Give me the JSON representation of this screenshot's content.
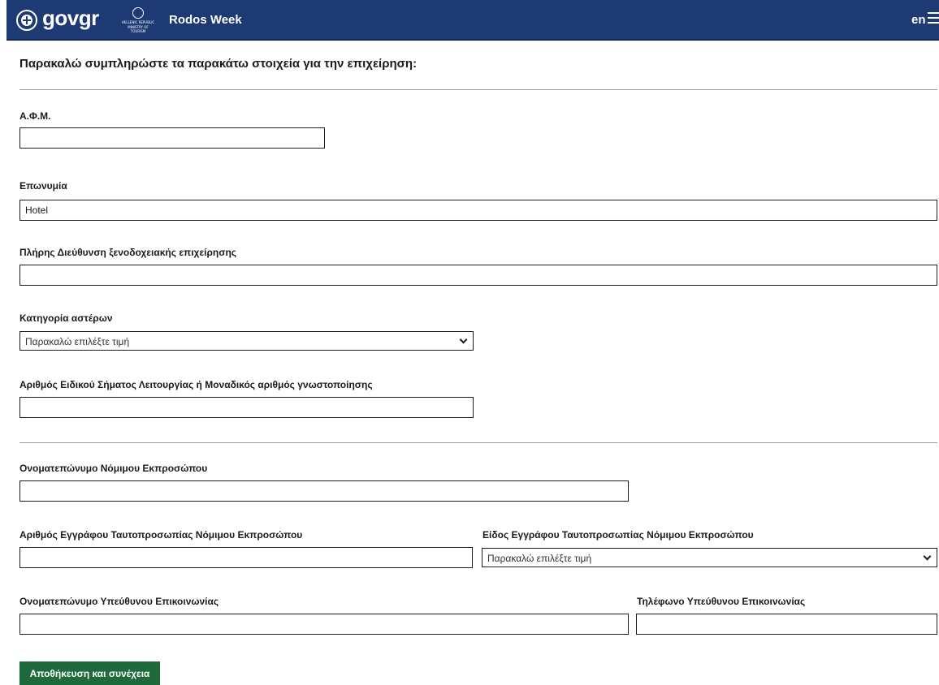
{
  "header": {
    "logo_text": "govgr",
    "ministry_logo": {
      "line1": "HELLENIC REPUBLIC",
      "line2": "MINISTRY OF TOURISM"
    },
    "site_title": "Rodos Week",
    "language": "en",
    "background_color": "#1d3a74",
    "menu_icon": "hamburger-icon"
  },
  "form": {
    "heading": "Παρακαλώ συμπληρώστε τα παρακάτω στοιχεία για την επιχείρηση:",
    "afm": {
      "label": "Α.Φ.Μ.",
      "value": ""
    },
    "eponymia": {
      "label": "Επωνυμία",
      "value": "Hotel"
    },
    "address": {
      "label": "Πλήρης Διεύθυνση ξενοδοχειακής επιχείρησης",
      "value": ""
    },
    "star_category": {
      "label": "Κατηγορία αστέρων",
      "selected": "Παρακαλώ επιλέξτε τιμή"
    },
    "license_number": {
      "label": "Αριθμός Ειδικού Σήματος Λειτουργίας ή Μοναδικός αριθμός γνωστοποίησης",
      "value": ""
    },
    "legal_rep_name": {
      "label": "Ονοματεπώνυμο Νόμιμου Εκπροσώπου",
      "value": ""
    },
    "legal_rep_id_number": {
      "label": "Αριθμός Εγγράφου Ταυτοπροσωπίας Νόμιμου Εκπροσώπου",
      "value": ""
    },
    "legal_rep_id_type": {
      "label": "Είδος Εγγράφου Ταυτοπροσωπίας Νόμιμου Εκπροσώπου",
      "selected": "Παρακαλώ επιλέξτε τιμή"
    },
    "contact_name": {
      "label": "Ονοματεπώνυμο Υπεύθυνου Επικοινωνίας",
      "value": ""
    },
    "contact_phone": {
      "label": "Τηλέφωνο Υπεύθυνου Επικοινωνίας",
      "value": ""
    },
    "save_label": "Αποθήκευση και συνέχεια",
    "save_color": "#1e6a3c"
  }
}
